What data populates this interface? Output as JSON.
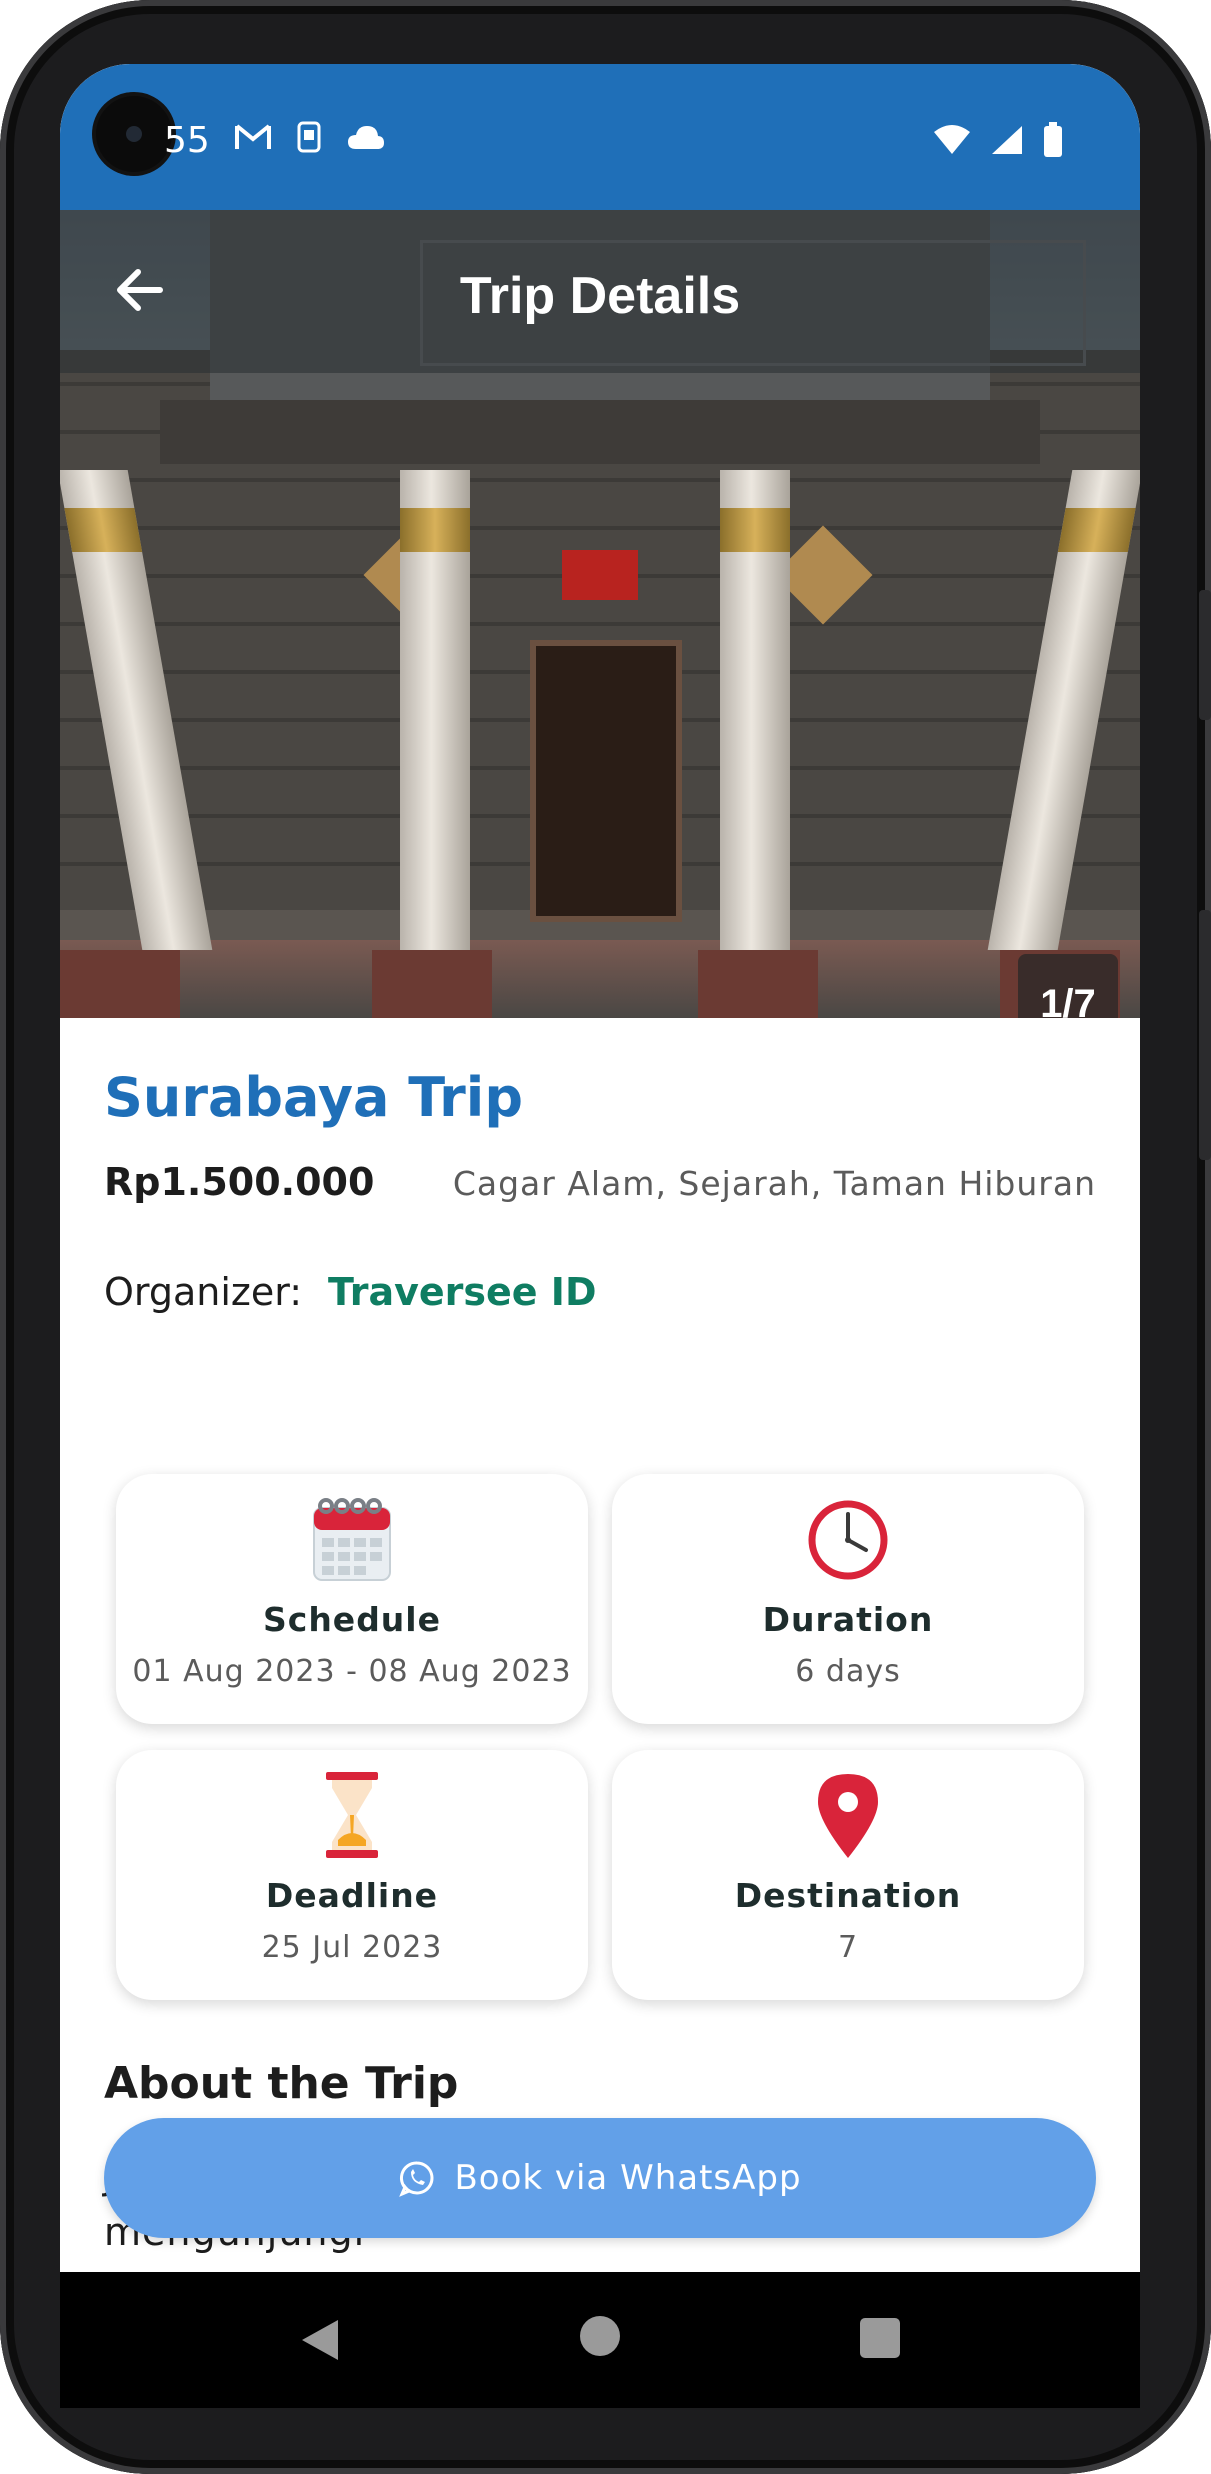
{
  "status_bar": {
    "time": "55",
    "icons": [
      "gmail-icon",
      "sim-icon",
      "cloud-icon"
    ],
    "right_icons": [
      "wifi-icon",
      "signal-icon",
      "battery-icon"
    ]
  },
  "header": {
    "title": "Trip Details",
    "image_counter": "1/7"
  },
  "trip": {
    "title": "Surabaya Trip",
    "price": "Rp1.500.000",
    "categories": "Cagar Alam, Sejarah, Taman Hiburan",
    "organizer_label": "Organizer:",
    "organizer_name": "Traversee ID"
  },
  "cards": [
    {
      "label": "Schedule",
      "value": "01 Aug 2023 - 08 Aug 2023",
      "icon": "calendar-icon"
    },
    {
      "label": "Duration",
      "value": "6 days",
      "icon": "clock-icon"
    },
    {
      "label": "Deadline",
      "value": "25 Jul 2023",
      "icon": "hourglass-icon"
    },
    {
      "label": "Destination",
      "value": "7",
      "icon": "location-pin-icon"
    }
  ],
  "about": {
    "title": "About the Trip",
    "text": "J                                                                                      a Bergabunglah dengan kami untuk mengunjungi"
  },
  "book_button": {
    "label": "Book via WhatsApp"
  },
  "colors": {
    "primary": "#1f6fb8",
    "organizer": "#0f7d62",
    "button": "#62a0e8"
  }
}
